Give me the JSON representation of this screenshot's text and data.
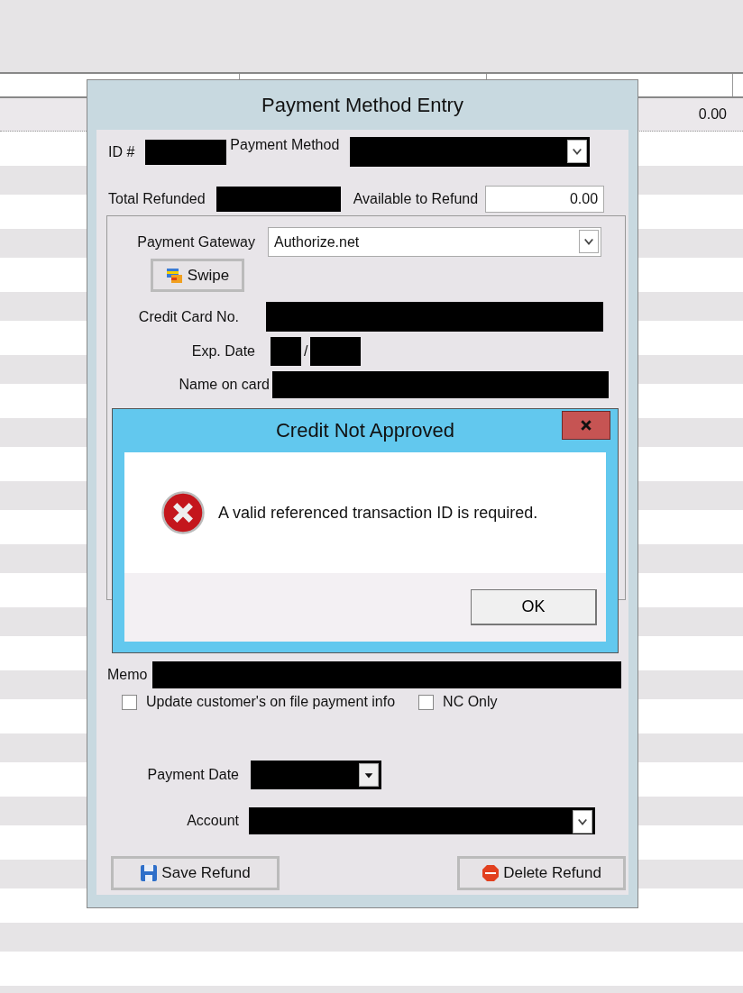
{
  "grid": {
    "row_values": [
      "0.00"
    ]
  },
  "window": {
    "title": "Payment Method Entry"
  },
  "id": {
    "label": "ID #",
    "redacted": true
  },
  "payment_method": {
    "label": "Payment Method",
    "redacted": true
  },
  "total_refunded": {
    "label": "Total Refunded",
    "redacted": true
  },
  "available_to_refund": {
    "label": "Available to Refund",
    "value": "0.00"
  },
  "payment_gateway": {
    "label": "Payment Gateway",
    "value": "Authorize.net"
  },
  "swipe_button": "Swipe",
  "credit_card_no": {
    "label": "Credit Card No.",
    "redacted": true
  },
  "exp_date": {
    "label": "Exp. Date",
    "separator": "/",
    "month_redacted": true,
    "year_redacted": true
  },
  "name_on_card": {
    "label": "Name on card",
    "redacted": true
  },
  "memo": {
    "label": "Memo",
    "redacted": true
  },
  "checkboxes": [
    {
      "label": "Update customer's on file payment info",
      "checked": false
    },
    {
      "label": "NC Only",
      "checked": false
    }
  ],
  "payment_date": {
    "label": "Payment Date",
    "redacted": true
  },
  "account": {
    "label": "Account",
    "redacted": true
  },
  "buttons": [
    {
      "label": "Save Refund",
      "kind": "save"
    },
    {
      "label": "Delete Refund",
      "kind": "delete"
    }
  ],
  "message_box": {
    "title": "Credit Not Approved",
    "message": "A valid referenced transaction ID is required.",
    "buttons": [
      "OK"
    ]
  }
}
